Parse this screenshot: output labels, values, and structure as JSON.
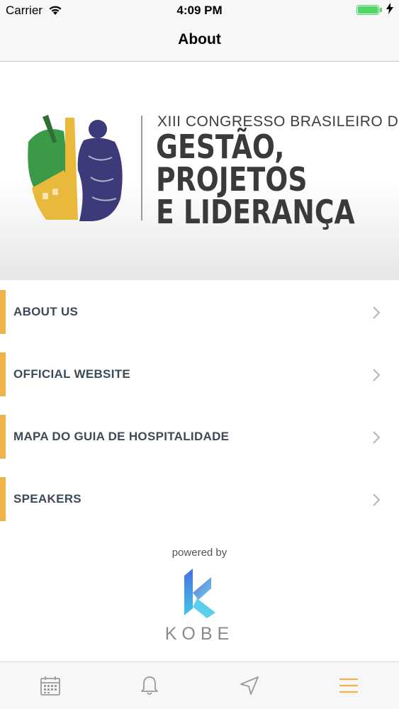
{
  "status_bar": {
    "carrier": "Carrier",
    "time": "4:09 PM",
    "battery_level": 1.0
  },
  "nav": {
    "title": "About"
  },
  "banner": {
    "subtitle": "XIII  CONGRESSO BRASILEIRO DE",
    "title_lines": [
      "GESTÃO,",
      "PROJETOS",
      "E LIDERANÇA"
    ]
  },
  "menu": {
    "items": [
      {
        "label": "ABOUT US"
      },
      {
        "label": "OFFICIAL WEBSITE"
      },
      {
        "label": "MAPA DO GUIA DE HOSPITALIDADE"
      },
      {
        "label": "SPEAKERS"
      }
    ]
  },
  "footer": {
    "powered_by": "powered by",
    "brand": "KOBE"
  },
  "tab_bar": {
    "tabs": [
      {
        "icon": "calendar-icon",
        "active": false
      },
      {
        "icon": "bell-icon",
        "active": false
      },
      {
        "icon": "location-arrow-icon",
        "active": false
      },
      {
        "icon": "menu-icon",
        "active": true
      }
    ],
    "active_color": "#f0b24a",
    "inactive_color": "#9a9a9a"
  },
  "colors": {
    "accent": "#f0b24a",
    "menu_text": "#3d4a57"
  }
}
